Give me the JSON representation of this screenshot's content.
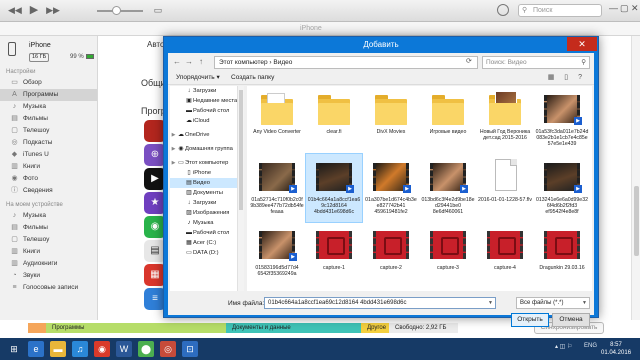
{
  "itunes": {
    "device_tab": "iPhone",
    "search_placeholder": "Поиск",
    "device": {
      "name": "iPhone",
      "capacity": "16 ГБ",
      "battery": "99 %"
    },
    "sidebar_section_settings": "Настройки",
    "sidebar_settings": [
      {
        "label": "Обзор",
        "icon": "▭"
      },
      {
        "label": "Программы",
        "icon": "A"
      },
      {
        "label": "Музыка",
        "icon": "♪"
      },
      {
        "label": "Фильмы",
        "icon": "▤"
      },
      {
        "label": "Телешоу",
        "icon": "▢"
      },
      {
        "label": "Подкасты",
        "icon": "◎"
      },
      {
        "label": "iTunes U",
        "icon": "◆"
      },
      {
        "label": "Книги",
        "icon": "▥"
      },
      {
        "label": "Фото",
        "icon": "◉"
      },
      {
        "label": "Сведения",
        "icon": "ⓘ"
      }
    ],
    "sidebar_section_device": "На моем устройстве",
    "sidebar_device": [
      {
        "label": "Музыка",
        "icon": "♪"
      },
      {
        "label": "Фильмы",
        "icon": "▤"
      },
      {
        "label": "Телешоу",
        "icon": "▢"
      },
      {
        "label": "Книги",
        "icon": "▥"
      },
      {
        "label": "Аудиокниги",
        "icon": "▥"
      },
      {
        "label": "Звуки",
        "icon": "◔"
      },
      {
        "label": "Голосовые записи",
        "icon": "≡"
      }
    ],
    "main_fragments": {
      "auto": "Авто",
      "general": "Общие",
      "programs": "Програ"
    },
    "storage": [
      {
        "label": "",
        "color": "#f5a65b"
      },
      {
        "label": "Программы",
        "color": "#b6dd69"
      },
      {
        "label": "Документы и данные",
        "color": "#3fc3b7"
      },
      {
        "label": "Другое",
        "color": "#f4d03f"
      },
      {
        "label": "Свободно: 2,92 ГБ",
        "color": "#ececec"
      }
    ],
    "sync_button": "Синхронизировать"
  },
  "dialog": {
    "title": "Добавить",
    "address_path": "Этот компьютер › Видео",
    "search_placeholder": "Поиск: Видео",
    "toolbar": {
      "organize": "Упорядочить ▾",
      "new_folder": "Создать папку"
    },
    "tree": [
      {
        "label": "Загрузки",
        "icon": "↓",
        "level": 1
      },
      {
        "label": "Недавние места",
        "icon": "▣",
        "level": 1
      },
      {
        "label": "Рабочий стол",
        "icon": "▬",
        "level": 1
      },
      {
        "label": "iCloud",
        "icon": "☁",
        "level": 1
      },
      {
        "label": "OneDrive",
        "icon": "☁",
        "level": 0
      },
      {
        "label": "Домашняя группа",
        "icon": "◉",
        "level": 0
      },
      {
        "label": "Этот компьютер",
        "icon": "▭",
        "level": 0
      },
      {
        "label": "iPhone",
        "icon": "▯",
        "level": 1
      },
      {
        "label": "Видео",
        "icon": "▤",
        "level": 1,
        "selected": true
      },
      {
        "label": "Документы",
        "icon": "▥",
        "level": 1
      },
      {
        "label": "Загрузки",
        "icon": "↓",
        "level": 1
      },
      {
        "label": "Изображения",
        "icon": "▨",
        "level": 1
      },
      {
        "label": "Музыка",
        "icon": "♪",
        "level": 1
      },
      {
        "label": "Рабочий стол",
        "icon": "▬",
        "level": 1
      },
      {
        "label": "Acer (C:)",
        "icon": "▦",
        "level": 1
      },
      {
        "label": "DATA (D:)",
        "icon": "▭",
        "level": 1
      }
    ],
    "files": [
      {
        "name": "Any Video Converter",
        "kind": "folder-doc"
      },
      {
        "name": "clear.fi",
        "kind": "folder"
      },
      {
        "name": "DivX Movies",
        "kind": "folder"
      },
      {
        "name": "Игровые видео",
        "kind": "folder"
      },
      {
        "name": "Новый Год Вероника дет.сад 2015-2016",
        "kind": "folder-photo"
      },
      {
        "name": "01a53fc3da011e7b24d083e2b1e1cb7e4c85e57e5e1e439",
        "kind": "vid face"
      },
      {
        "name": "01a52714c710f0b2c0f9b389ee477b72db54fefeaaa",
        "kind": "vid dark"
      },
      {
        "name": "01b4c664a1a8ccf1ea69c12d8164 4bdd431e698d6c",
        "kind": "vid stage",
        "selected": true
      },
      {
        "name": "01a307be1d674c4b3ee827742b41 459619481fe2",
        "kind": "vid orange"
      },
      {
        "name": "013bd6c3f4e2d9be18ed29441be0 8e6df460061",
        "kind": "vid face"
      },
      {
        "name": "2016-01-01-1228-57.flv",
        "kind": "pdoc"
      },
      {
        "name": "013241e6e6a0d99e32 6f4d6b2f2fd3 ef9542f4e8e8f",
        "kind": "vid stage"
      },
      {
        "name": "01583196d5d77d4 6542f35369249a",
        "kind": "vid face"
      },
      {
        "name": "capture-1",
        "kind": "vid film"
      },
      {
        "name": "capture-2",
        "kind": "vid film"
      },
      {
        "name": "capture-3",
        "kind": "vid film"
      },
      {
        "name": "capture-4",
        "kind": "vid film"
      },
      {
        "name": "Dragunkin 29.03.16",
        "kind": "vid film"
      }
    ],
    "filename_label": "Имя файла:",
    "filename_value": "01b4c664a1a8ccf1ea69c12d8164 4bdd431e698d6c",
    "filetype_value": "Все файлы (*.*)",
    "open_button": "Открыть",
    "cancel_button": "Отмена"
  },
  "taskbar": {
    "apps": [
      {
        "icon": "⊞",
        "color": "#163a66"
      },
      {
        "icon": "e",
        "color": "#2b72c8"
      },
      {
        "icon": "▬",
        "color": "#e8b63a"
      },
      {
        "icon": "♫",
        "color": "#2a88d8"
      },
      {
        "icon": "◉",
        "color": "#d93a2a"
      },
      {
        "icon": "W",
        "color": "#2b5797"
      },
      {
        "icon": "⬤",
        "color": "#4caf50"
      },
      {
        "icon": "◎",
        "color": "#c64b3a"
      },
      {
        "icon": "⊡",
        "color": "#2d6cbf"
      }
    ],
    "lang": "ENG",
    "time": "8:57",
    "date": "01.04.2016"
  }
}
